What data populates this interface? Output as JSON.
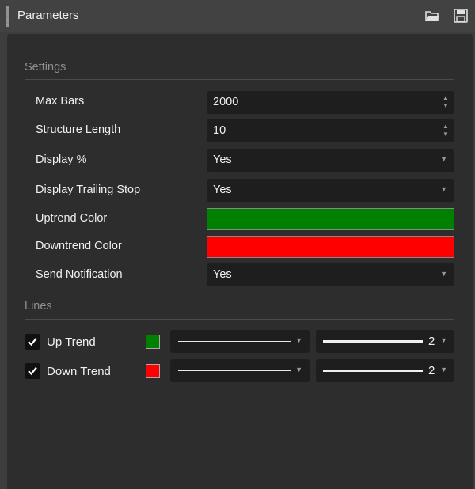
{
  "window": {
    "title": "Parameters",
    "icons": [
      "open-folder-icon",
      "save-icon"
    ]
  },
  "settings": {
    "heading": "Settings",
    "max_bars": {
      "label": "Max Bars",
      "value": "2000"
    },
    "structure_length": {
      "label": "Structure Length",
      "value": "10"
    },
    "display_percent": {
      "label": "Display %",
      "value": "Yes"
    },
    "display_trailing_stop": {
      "label": "Display Trailing Stop",
      "value": "Yes"
    },
    "uptrend_color": {
      "label": "Uptrend Color",
      "color": "#008000"
    },
    "downtrend_color": {
      "label": "Downtrend Color",
      "color": "#ff0000"
    },
    "send_notification": {
      "label": "Send Notification",
      "value": "Yes"
    }
  },
  "lines": {
    "heading": "Lines",
    "up_trend": {
      "checked": true,
      "label": "Up Trend",
      "color": "#008000",
      "style": "solid",
      "width": "2"
    },
    "down_trend": {
      "checked": true,
      "label": "Down Trend",
      "color": "#ff0000",
      "style": "solid",
      "width": "2"
    }
  }
}
